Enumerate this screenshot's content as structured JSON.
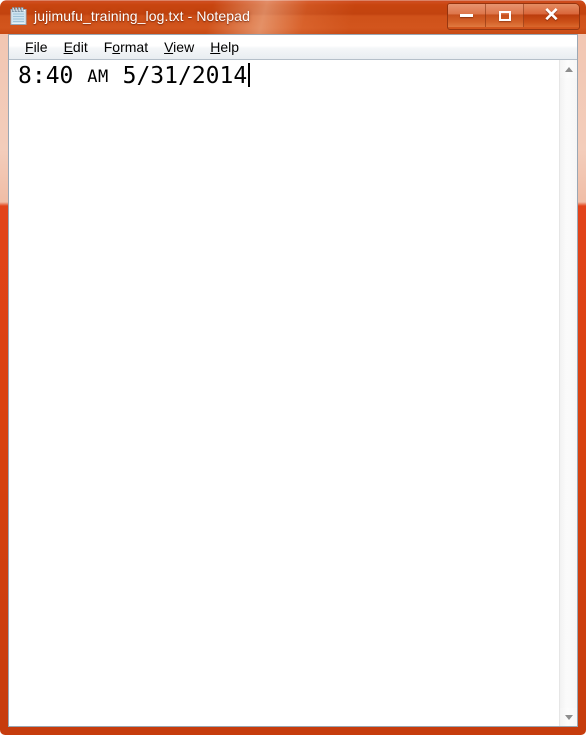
{
  "window": {
    "title": "jujimufu_training_log.txt - Notepad",
    "icon": "notepad-icon",
    "accent_color": "#d9420f",
    "titlebar_color": "#c8450f",
    "controls": {
      "minimize_label": "—",
      "maximize_label": "□",
      "close_label": "✕"
    }
  },
  "menubar": {
    "items": [
      {
        "label": "File",
        "accesskey_prefix": "",
        "accesskey": "F",
        "accesskey_suffix": "ile"
      },
      {
        "label": "Edit",
        "accesskey_prefix": "",
        "accesskey": "E",
        "accesskey_suffix": "dit"
      },
      {
        "label": "Format",
        "accesskey_prefix": "F",
        "accesskey": "o",
        "accesskey_suffix": "rmat"
      },
      {
        "label": "View",
        "accesskey_prefix": "",
        "accesskey": "V",
        "accesskey_suffix": "iew"
      },
      {
        "label": "Help",
        "accesskey_prefix": "",
        "accesskey": "H",
        "accesskey_suffix": "elp"
      }
    ]
  },
  "document": {
    "lines": [
      {
        "time": "8:40",
        "meridiem": "AM",
        "date": "5/31/2014",
        "full_text": "8:40 AM 5/31/2014"
      }
    ],
    "caret_visible": true
  },
  "scrollbar": {
    "up_arrow": "scroll-up-arrow",
    "down_arrow": "scroll-down-arrow",
    "thumb_visible": false
  }
}
